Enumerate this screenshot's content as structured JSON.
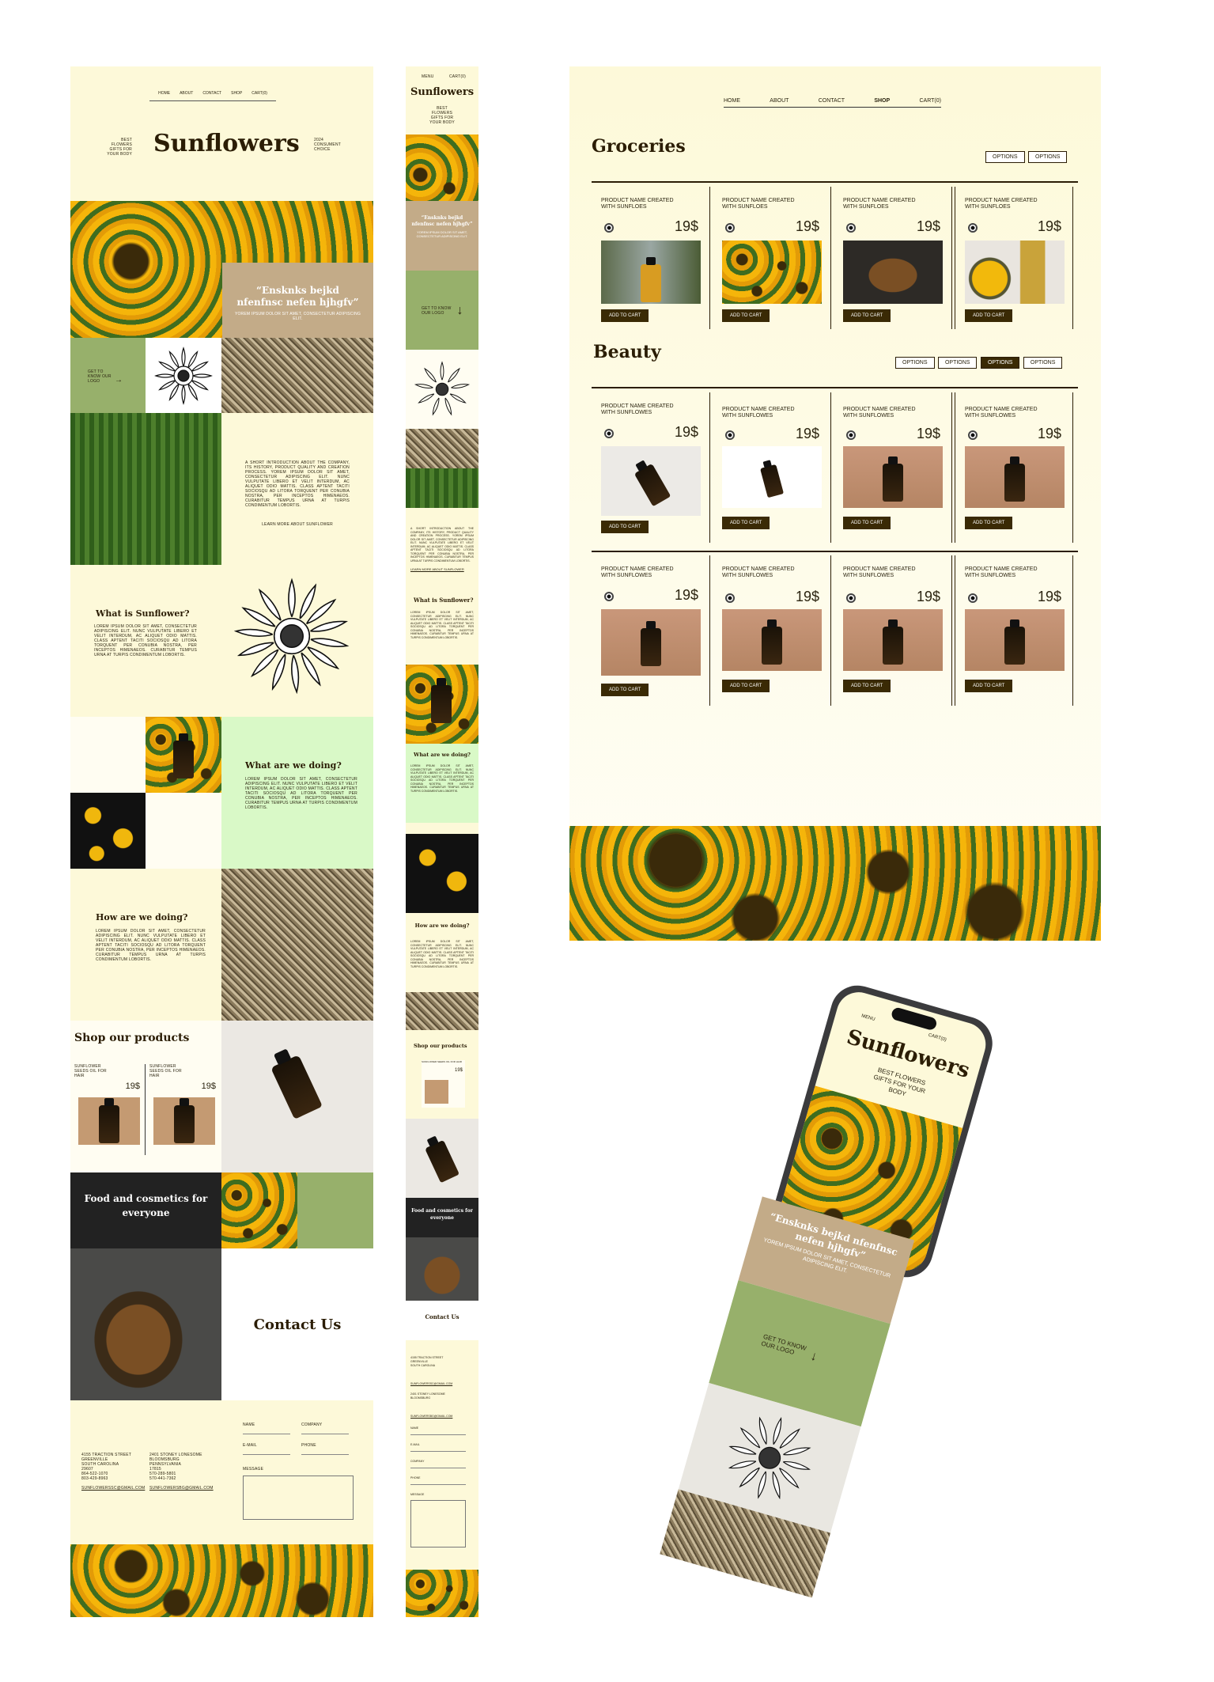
{
  "nav": {
    "items": [
      "HOME",
      "ABOUT",
      "CONTACT",
      "SHOP",
      "CART(0)"
    ],
    "mobile_menu": "MENU",
    "mobile_cart": "CART(0)"
  },
  "hero": {
    "brand": "Sunflowers",
    "tag_left": "BEST FLOWERS GIFTS FOR YOUR BODY",
    "tag_right": "2024 CONSUMENT CHOICE"
  },
  "quote": {
    "title": "“Ensknks bejkd nfenfnsc nefen hjhgfv”",
    "sub": "YOREM IPSUM DOLOR SIT AMET, CONSECTETUR ADIPISCING ELIT."
  },
  "logo_link": "GET TO KNOW OUR LOGO",
  "intro": {
    "text": "A SHORT INTRODUCTION ABOUT THE COMPANY, ITS HISTORY, PRODUCT QUALITY AND CREATION PROCESS. YOREM IPSUM DOLOR SIT AMET, CONSECTETUR ADIPISCING ELIT. NUNC VULPUTATE LIBERO ET VELIT INTERDUM, AC ALIQUET ODIO MATTIS. CLASS APTENT TACITI SOCIOSQU AD LITORA TORQUENT PER CONUBIA NOSTRA, PER INCEPTOS HIMENAEOS. CURABITUR TEMPUS URNA AT TURPIS CONDIMENTUM LOBORTIS.",
    "link": "LEARN MORE ABOUT SUNFLOWER"
  },
  "sections": [
    {
      "title": "What is Sunflower?",
      "text": "LOREM IPSUM DOLOR SIT AMET, CONSECTETUR ADIPISCING ELIT. NUNC VULPUTATE LIBERO ET VELIT INTERDUM, AC ALIQUET ODIO MATTIS. CLASS APTENT TACITI SOCIOSQU AD LITORA TORQUENT PER CONUBIA NOSTRA, PER INCEPTOS HIMENAEOS. CURABITUR TEMPUS URNA AT TURPIS CONDIMENTUM LOBORTIS."
    },
    {
      "title": "What are we doing?",
      "text": "LOREM IPSUM DOLOR SIT AMET, CONSECTETUR ADIPISCING ELIT. NUNC VULPUTATE LIBERO ET VELIT INTERDUM, AC ALIQUET ODIO MATTIS. CLASS APTENT TACITI SOCIOSQU AD LITORA TORQUENT PER CONUBIA NOSTRA, PER INCEPTOS HIMENAEOS. CURABITUR TEMPUS URNA AT TURPIS CONDIMENTUM LOBORTIS."
    },
    {
      "title": "How are we doing?",
      "text": "LOREM IPSUM DOLOR SIT AMET, CONSECTETUR ADIPISCING ELIT. NUNC VULPUTATE LIBERO ET VELIT INTERDUM, AC ALIQUET ODIO MATTIS. CLASS APTENT TACITI SOCIOSQU AD LITORA TORQUENT PER CONUBIA NOSTRA, PER INCEPTOS HIMENAEOS. CURABITUR TEMPUS URNA AT TURPIS CONDIMENTUM LOBORTIS."
    }
  ],
  "shop_home": {
    "title": "Shop our products",
    "items": [
      {
        "name": "SUNFLOWER SEEDS OIL FOR HAIR",
        "price": "19$"
      },
      {
        "name": "SUNFLOWER SEEDS OIL FOR HAIR",
        "price": "19$"
      }
    ]
  },
  "food_title": "Food and cosmetics for everyone",
  "contact": {
    "title": "Contact Us",
    "addr1": [
      "4155 TRACTION STREET",
      "GREENVILLE",
      "SOUTH CAROLINA",
      "29607",
      "864-522-1070",
      "803-429-8963"
    ],
    "addr2": [
      "2401 STONEY LONESOME",
      "BLOOMSBURG",
      "PENNSYLVANIA",
      "17815",
      "570-289-5801",
      "570-441-7362"
    ],
    "email1": "SUNFLOWERSSC@GMAIL.COM",
    "email2": "SUNFLOWERSBG@GMAIL.COM",
    "fields": [
      "NAME",
      "COMPANY",
      "E-MAIL",
      "PHONE",
      "MESSAGE"
    ]
  },
  "shop": {
    "groceries": "Groceries",
    "beauty": "Beauty",
    "options": "OPTIONS",
    "product_g": "PRODUCT NAME CREATED WITH SUNFLOES",
    "product_b1": "PRODUCT NAME CREATED WITH SUNFLOWES",
    "product_b2": "PRODUCT NAME CREATED WITH SUNFLOWES",
    "price": "19$",
    "add": "ADD TO CART"
  },
  "phone": {
    "menu": "MENU",
    "cart": "CART(0)",
    "brand": "Sunflowers",
    "tag": "BEST FLOWERS GIFTS FOR YOUR BODY",
    "quote": "“Ensknks bejkd nfenfnsc nefen hjhgfv”",
    "sub": "YOREM IPSUM DOLOR SIT AMET, CONSECTETUR ADIPISCING ELIT.",
    "link": "GET TO KNOW OUR LOGO"
  }
}
